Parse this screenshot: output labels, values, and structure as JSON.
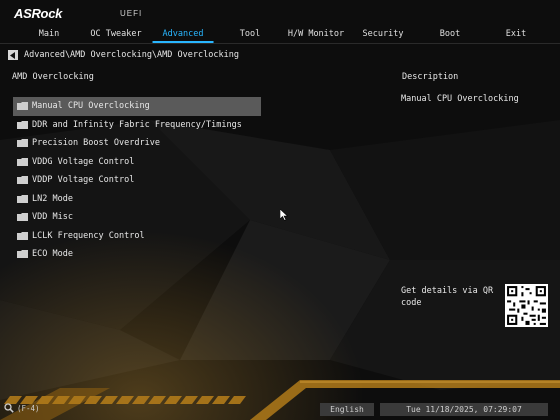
{
  "brand": {
    "logo": "ASRock",
    "subtitle": "UEFI"
  },
  "nav": {
    "tabs": [
      {
        "label": "Main"
      },
      {
        "label": "OC Tweaker"
      },
      {
        "label": "Advanced"
      },
      {
        "label": "Tool"
      },
      {
        "label": "H/W Monitor"
      },
      {
        "label": "Security"
      },
      {
        "label": "Boot"
      },
      {
        "label": "Exit"
      }
    ],
    "active_tab": "Advanced"
  },
  "breadcrumb": {
    "path": "Advanced\\AMD Overclocking\\AMD Overclocking"
  },
  "main": {
    "section_title": "AMD Overclocking",
    "items": [
      {
        "label": "Manual CPU Overclocking",
        "icon": "folder-icon"
      },
      {
        "label": "DDR and Infinity Fabric Frequency/Timings",
        "icon": "folder-icon"
      },
      {
        "label": "Precision Boost Overdrive",
        "icon": "folder-icon"
      },
      {
        "label": "VDDG Voltage Control",
        "icon": "folder-icon"
      },
      {
        "label": "VDDP Voltage Control",
        "icon": "folder-icon"
      },
      {
        "label": "LN2 Mode",
        "icon": "folder-icon"
      },
      {
        "label": "VDD Misc",
        "icon": "folder-icon"
      },
      {
        "label": "LCLK Frequency Control",
        "icon": "folder-icon"
      },
      {
        "label": "ECO Mode",
        "icon": "folder-icon"
      }
    ],
    "selected_item": "Manual CPU Overclocking"
  },
  "description": {
    "title": "Description",
    "text": "Manual CPU Overclocking",
    "qr_text": "Get details via QR code"
  },
  "footer": {
    "search_label": "(F-4)",
    "language": "English",
    "datetime": "Tue 11/18/2025, 07:29:07"
  },
  "colors": {
    "accent": "#29b6ff",
    "selection": "#5a5a5a",
    "background": "#0c0c0c",
    "stripe": "#b07a1a"
  }
}
